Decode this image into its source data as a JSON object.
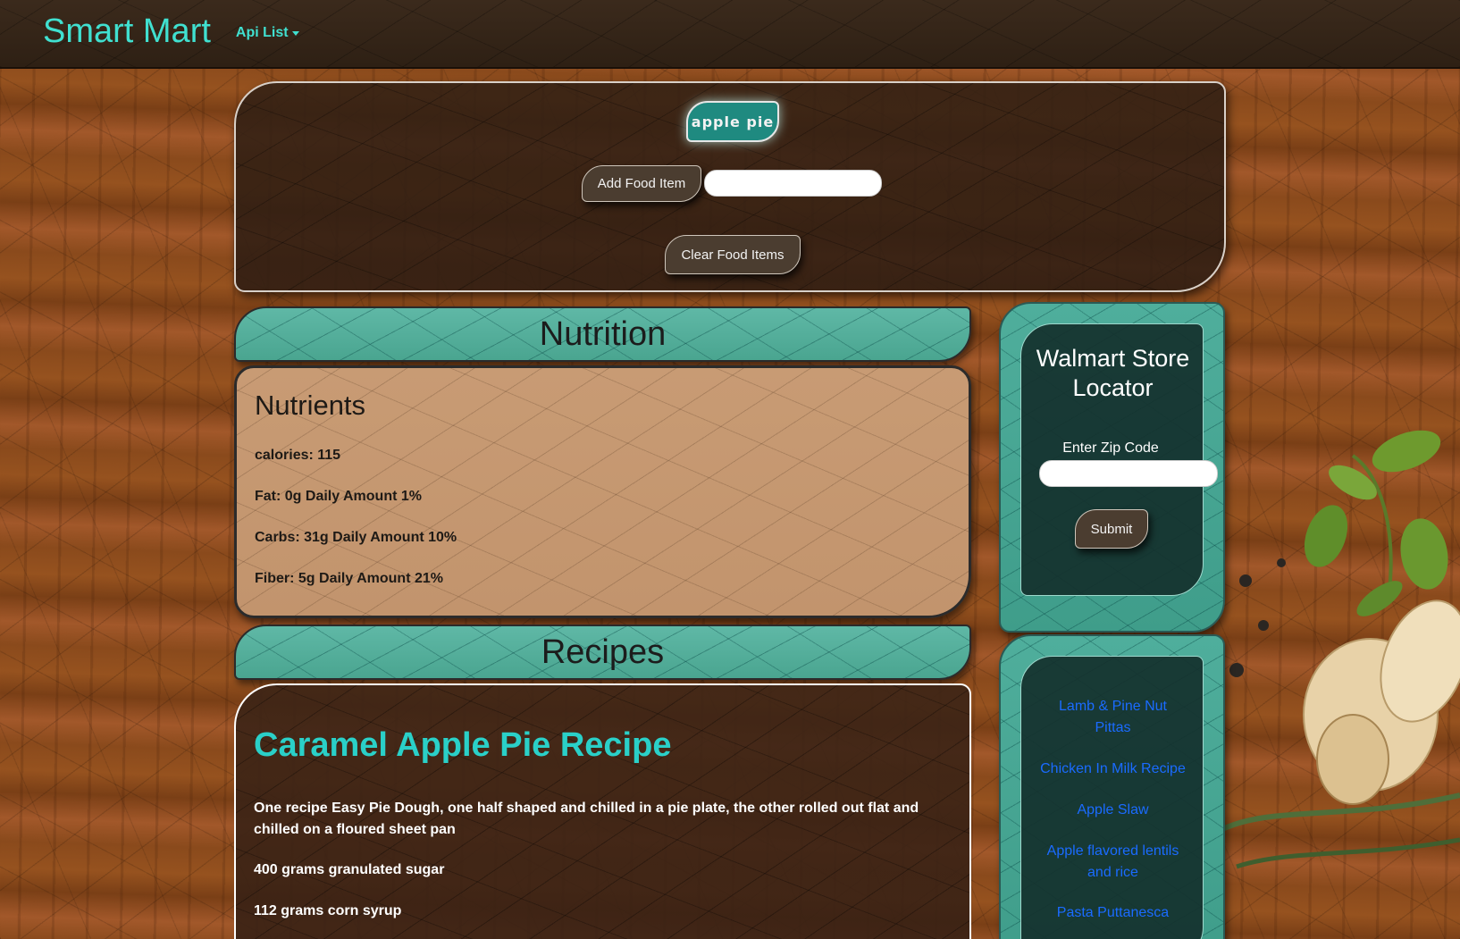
{
  "navbar": {
    "brand": "Smart Mart",
    "api_list": "Api List"
  },
  "search": {
    "food_items": [
      "apple pie"
    ],
    "add_button": "Add Food Item",
    "food_input_value": "",
    "clear_button": "Clear Food Items"
  },
  "nutrition": {
    "banner": "Nutrition",
    "heading": "Nutrients",
    "lines": [
      "calories: 115",
      "Fat: 0g Daily Amount 1%",
      "Carbs: 31g Daily Amount 10%",
      "Fiber: 5g Daily Amount 21%"
    ]
  },
  "recipes": {
    "banner": "Recipes",
    "title": "Caramel Apple Pie Recipe",
    "ingredients": [
      "One recipe Easy Pie Dough, one half shaped and chilled in a pie plate, the other rolled out flat and chilled on a floured sheet pan",
      "400 grams granulated sugar",
      "112 grams corn syrup"
    ]
  },
  "store_locator": {
    "title": "Walmart Store Locator",
    "zip_label": "Enter Zip Code",
    "zip_value": "",
    "submit": "Submit"
  },
  "recipe_links": [
    "Lamb & Pine Nut Pittas",
    "Chicken In Milk Recipe",
    "Apple Slaw",
    "Apple flavored lentils and rice",
    "Pasta Puttanesca"
  ],
  "colors": {
    "accent": "#40e0d0",
    "recipe_title": "#2ad0c8",
    "panel_teal": "#4fae9c",
    "link": "#1a6bff"
  }
}
